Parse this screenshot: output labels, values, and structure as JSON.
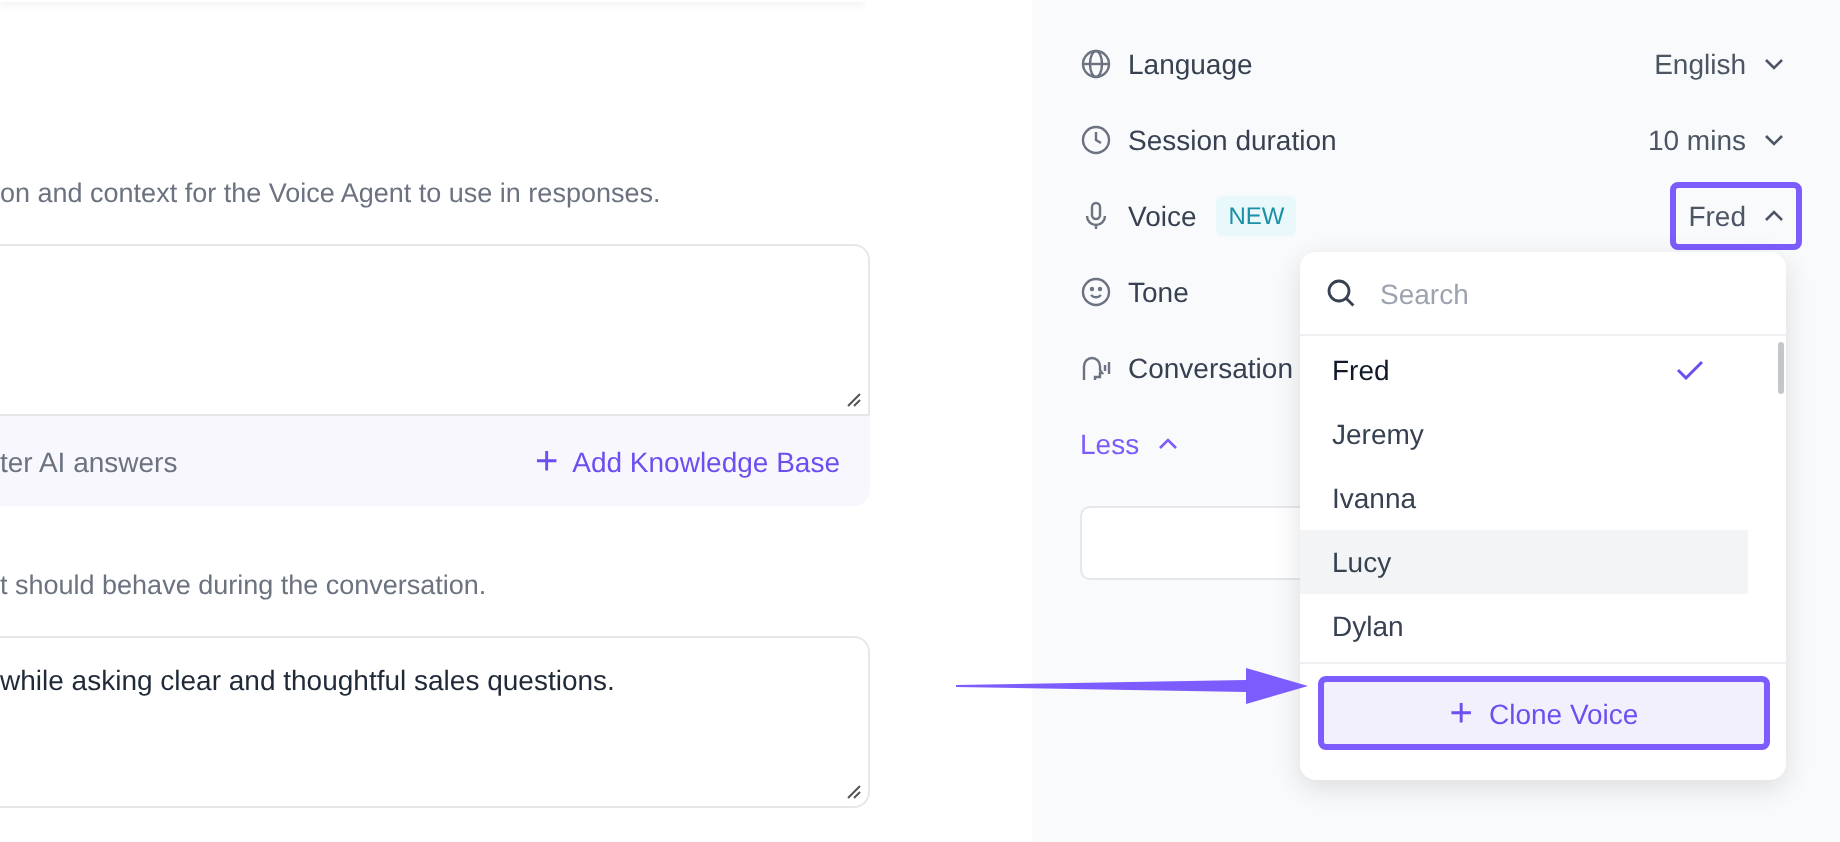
{
  "left": {
    "knowledge_hint": "on and context for the Voice Agent to use in responses.",
    "knowledge_footer": {
      "note": "ter AI answers",
      "action_icon": "+",
      "action": "Add Knowledge Base"
    },
    "behavior_hint": "t should behave during the conversation.",
    "behavior_field": {
      "value": "while asking clear and thoughtful sales questions."
    }
  },
  "settings": {
    "rows": [
      {
        "kind": "language",
        "label": "Language",
        "value": "English",
        "open": false,
        "highlighted": false
      },
      {
        "kind": "duration",
        "label": "Session duration",
        "value": "10 mins",
        "open": false,
        "highlighted": false
      },
      {
        "kind": "voice",
        "label": "Voice",
        "badge": "NEW",
        "value": "Fred",
        "open": true,
        "highlighted": true
      },
      {
        "kind": "tone",
        "label": "Tone"
      },
      {
        "kind": "conversation",
        "label": "Conversation"
      }
    ],
    "less_toggle": "Less"
  },
  "voice_dropdown": {
    "search": {
      "placeholder": "Search"
    },
    "items": [
      {
        "label": "Fred",
        "selected": true,
        "hovered": false
      },
      {
        "label": "Jeremy",
        "selected": false,
        "hovered": false
      },
      {
        "label": "Ivanna",
        "selected": false,
        "hovered": false
      },
      {
        "label": "Lucy",
        "selected": false,
        "hovered": true
      },
      {
        "label": "Dylan",
        "selected": false,
        "hovered": false
      }
    ],
    "clone_button": {
      "icon": "+",
      "label": "Clone Voice",
      "highlighted": true
    }
  }
}
